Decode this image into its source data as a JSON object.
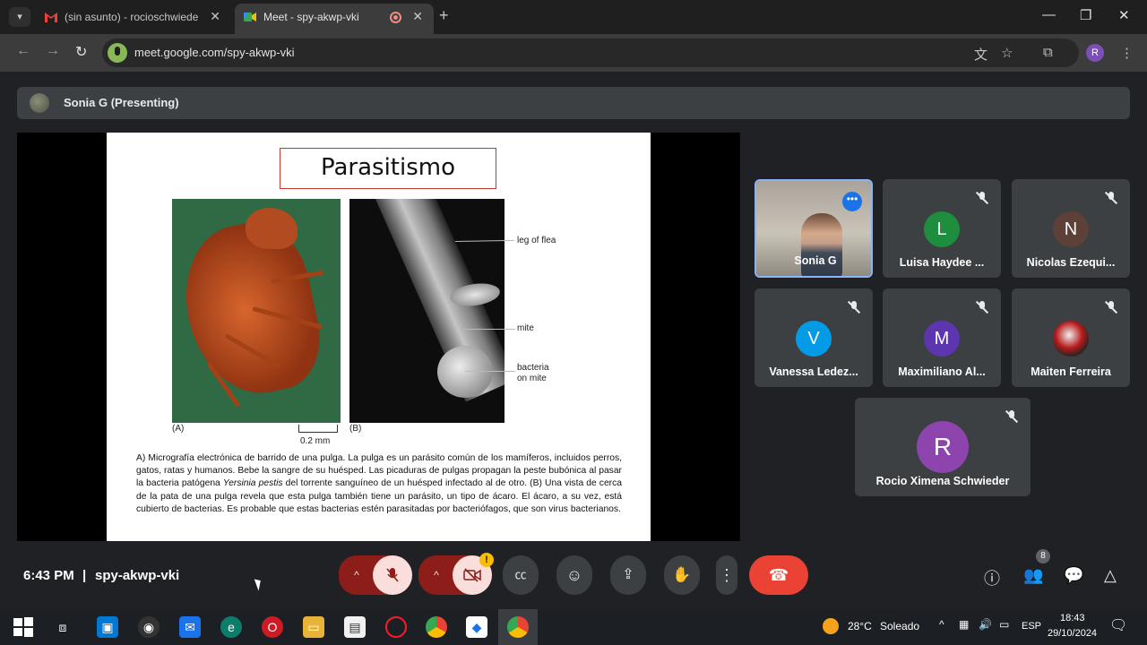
{
  "browser": {
    "tabs": [
      {
        "title": "(sin asunto) - rocioschwieder@",
        "active": false
      },
      {
        "title": "Meet - spy-akwp-vki",
        "active": true
      }
    ],
    "url": "meet.google.com/spy-akwp-vki",
    "profile_initial": "R"
  },
  "meet": {
    "presenter_label": "Sonia G (Presenting)",
    "slide": {
      "title": "Parasitismo",
      "fig_label_a": "(A)",
      "fig_label_b": "(B)",
      "scale": "0.2 mm",
      "callouts": [
        "leg of flea",
        "mite",
        "bacteria on mite"
      ],
      "caption_part1": "A) Micrografía electrónica de barrido de una pulga. La pulga es un parásito común de los mamíferos, incluidos perros, gatos, ratas y humanos. Bebe la sangre de su huésped. Las picaduras de pulgas propagan la peste bubónica al pasar la bacteria patógena ",
      "caption_italic": "Yersinia pestis",
      "caption_part2": " del torrente sanguíneo de un huésped infectado al de otro. (B) Una vista de cerca de la pata de una pulga revela que esta pulga también tiene un parásito, un tipo de ácaro. El ácaro, a su vez, está cubierto de bacterias. Es probable que estas bacterias estén parasitadas por bacteriófagos, que son virus bacterianos."
    },
    "participants": [
      {
        "name": "Sonia G",
        "initial": "",
        "color": "",
        "video": true,
        "muted": false
      },
      {
        "name": "Luisa Haydee ...",
        "initial": "L",
        "color": "#1e8e3e",
        "video": false,
        "muted": true
      },
      {
        "name": "Nicolas Ezequi...",
        "initial": "N",
        "color": "#5d4037",
        "video": false,
        "muted": true
      },
      {
        "name": "Vanessa Ledez...",
        "initial": "V",
        "color": "#039be5",
        "video": false,
        "muted": true
      },
      {
        "name": "Maximiliano Al...",
        "initial": "M",
        "color": "#5e35b1",
        "video": false,
        "muted": true
      },
      {
        "name": "Maiten Ferreira",
        "initial": "",
        "color": "#b71c1c",
        "video": false,
        "muted": true
      },
      {
        "name": "Rocio Ximena Schwieder",
        "initial": "R",
        "color": "#8e44ad",
        "video": false,
        "muted": true
      }
    ],
    "time": "6:43 PM",
    "separator": "|",
    "meeting_code": "spy-akwp-vki",
    "people_count": "8",
    "warning_glyph": "!"
  },
  "taskbar": {
    "weather_temp": "28°C",
    "weather_text": "Soleado",
    "language": "ESP",
    "clock_time": "18:43",
    "clock_date": "29/10/2024"
  }
}
